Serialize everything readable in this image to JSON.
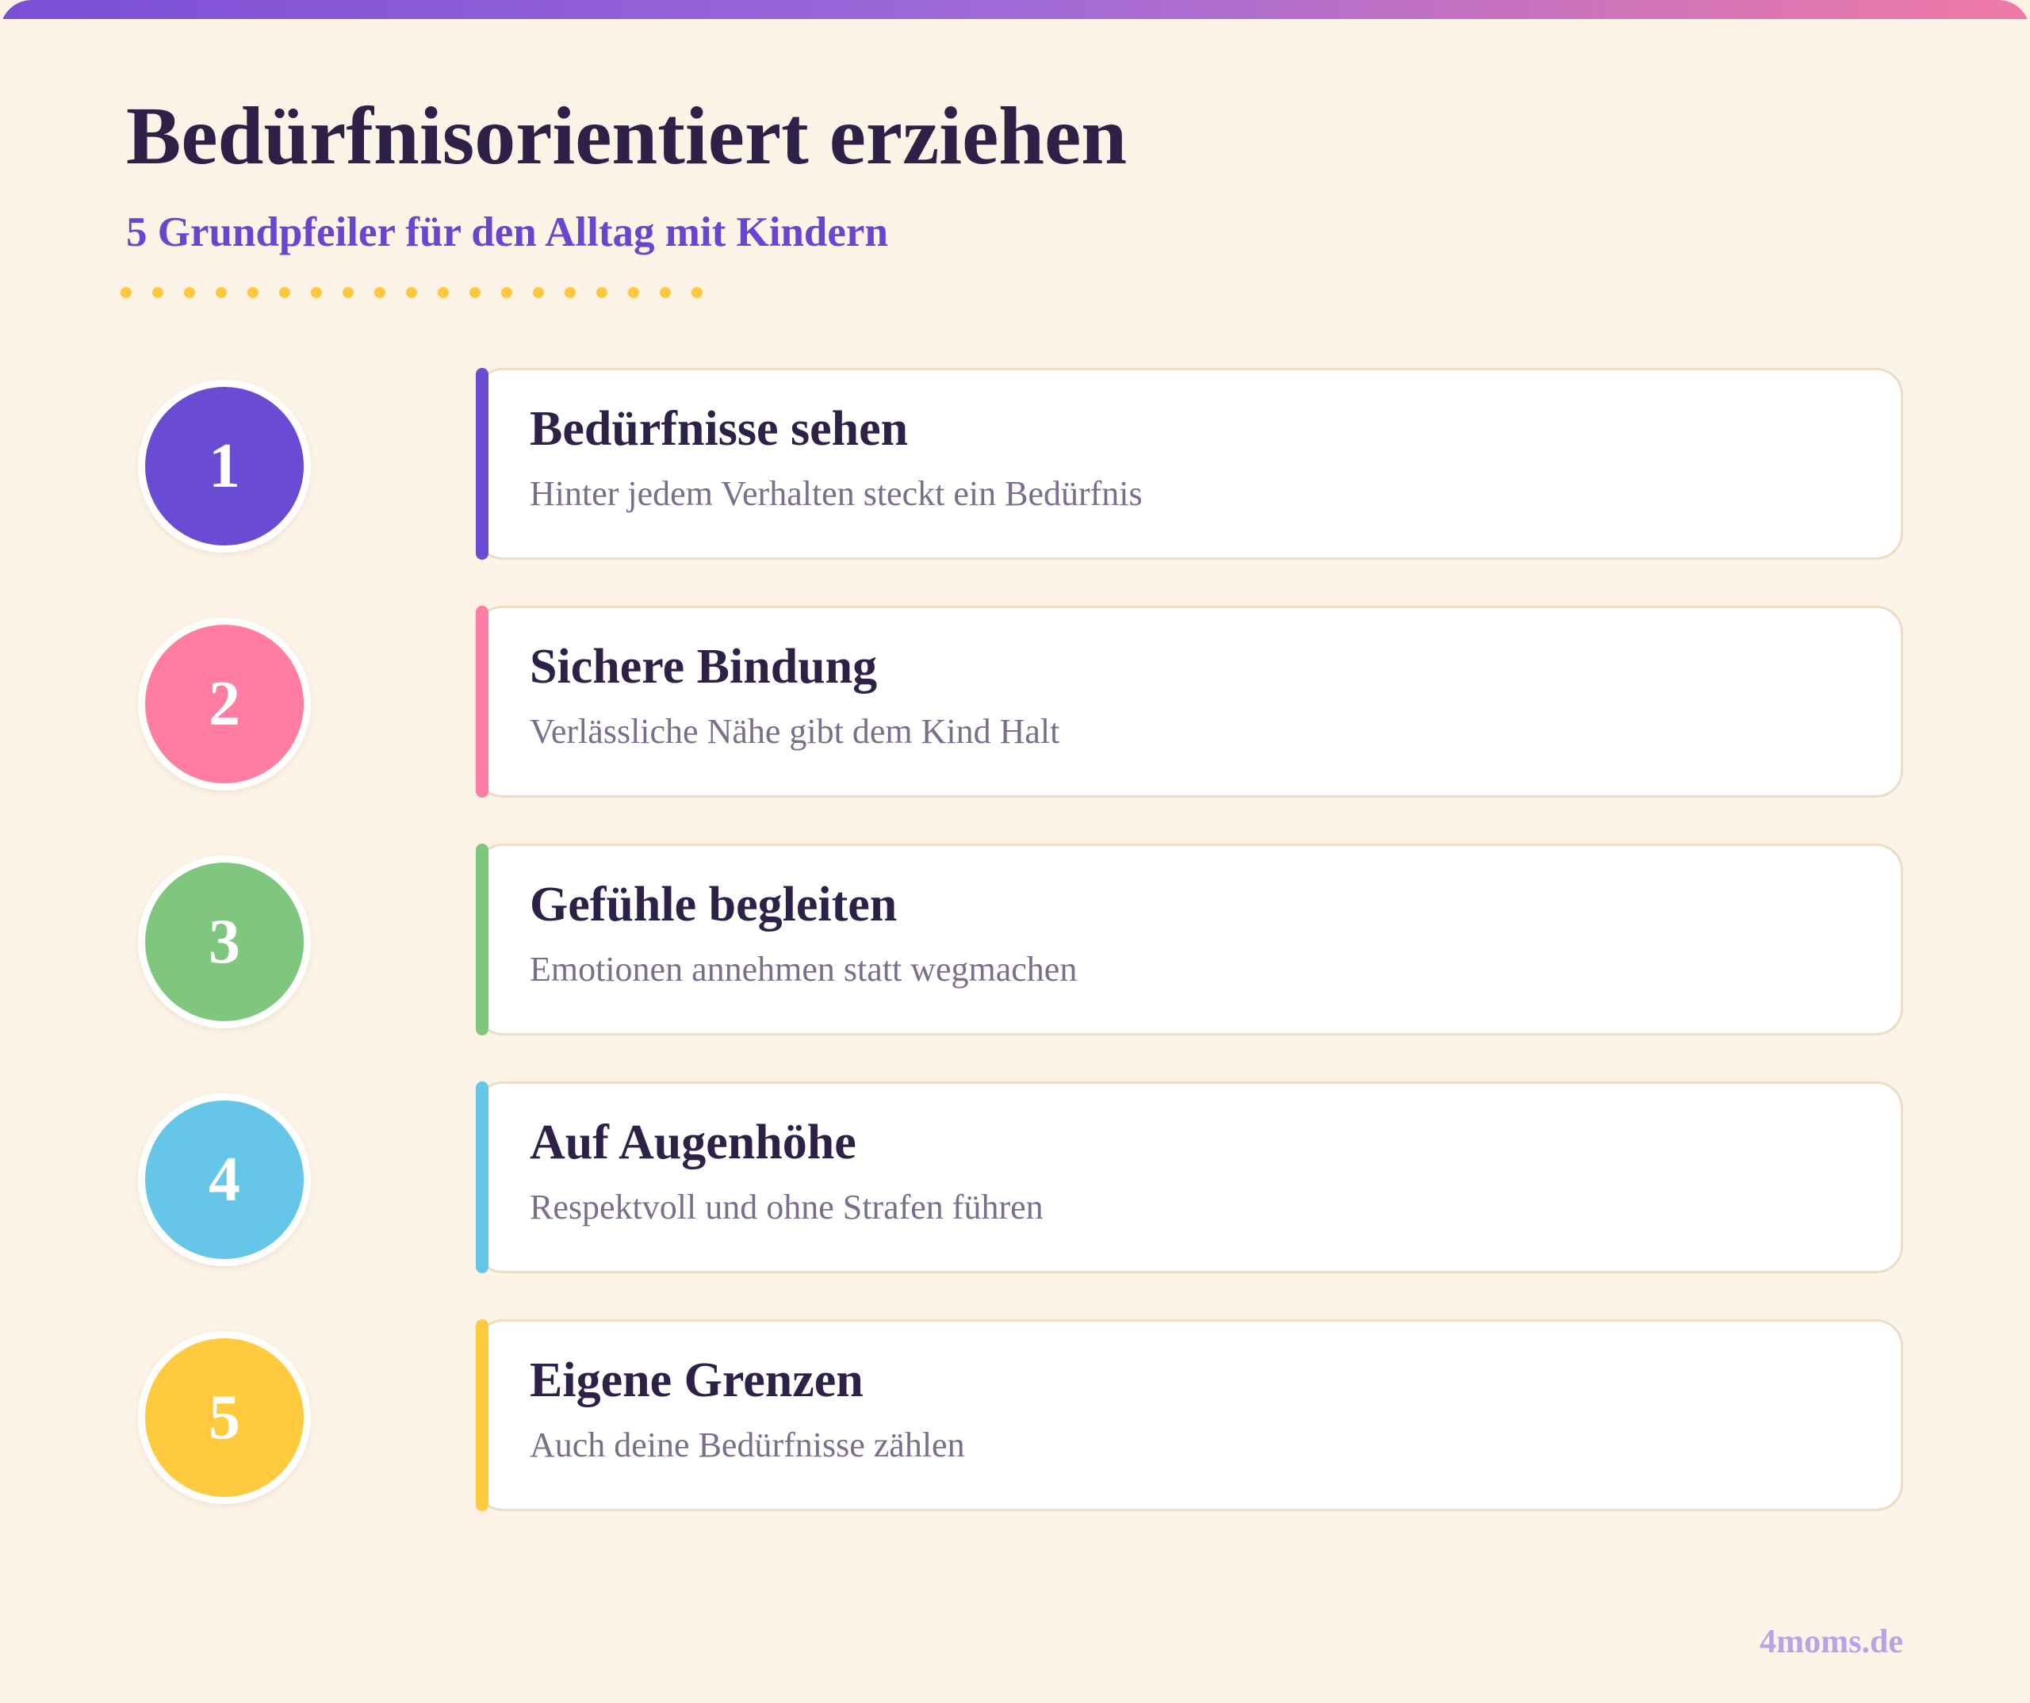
{
  "header": {
    "title": "Bedürfnisorientiert erziehen",
    "subtitle": "5 Grundpfeiler für den Alltag mit Kindern"
  },
  "items": [
    {
      "number": "1",
      "title": "Bedürfnisse sehen",
      "description": "Hinter jedem Verhalten steckt ein Bedürfnis",
      "color": "#6a4bd3"
    },
    {
      "number": "2",
      "title": "Sichere Bindung",
      "description": "Verlässliche Nähe gibt dem Kind Halt",
      "color": "#ff7da3"
    },
    {
      "number": "3",
      "title": "Gefühle begleiten",
      "description": "Emotionen annehmen statt wegmachen",
      "color": "#7fc67e"
    },
    {
      "number": "4",
      "title": "Auf Augenhöhe",
      "description": "Respektvoll und ohne Strafen führen",
      "color": "#65c6e8"
    },
    {
      "number": "5",
      "title": "Eigene Grenzen",
      "description": "Auch deine Bedürfnisse zählen",
      "color": "#ffca3d"
    }
  ],
  "footer": {
    "brand": "4moms.de"
  },
  "colors": {
    "background": "#fdf3e6",
    "title": "#2e2148",
    "subtitle": "#6a45cf",
    "dots": "#ffc83d"
  }
}
